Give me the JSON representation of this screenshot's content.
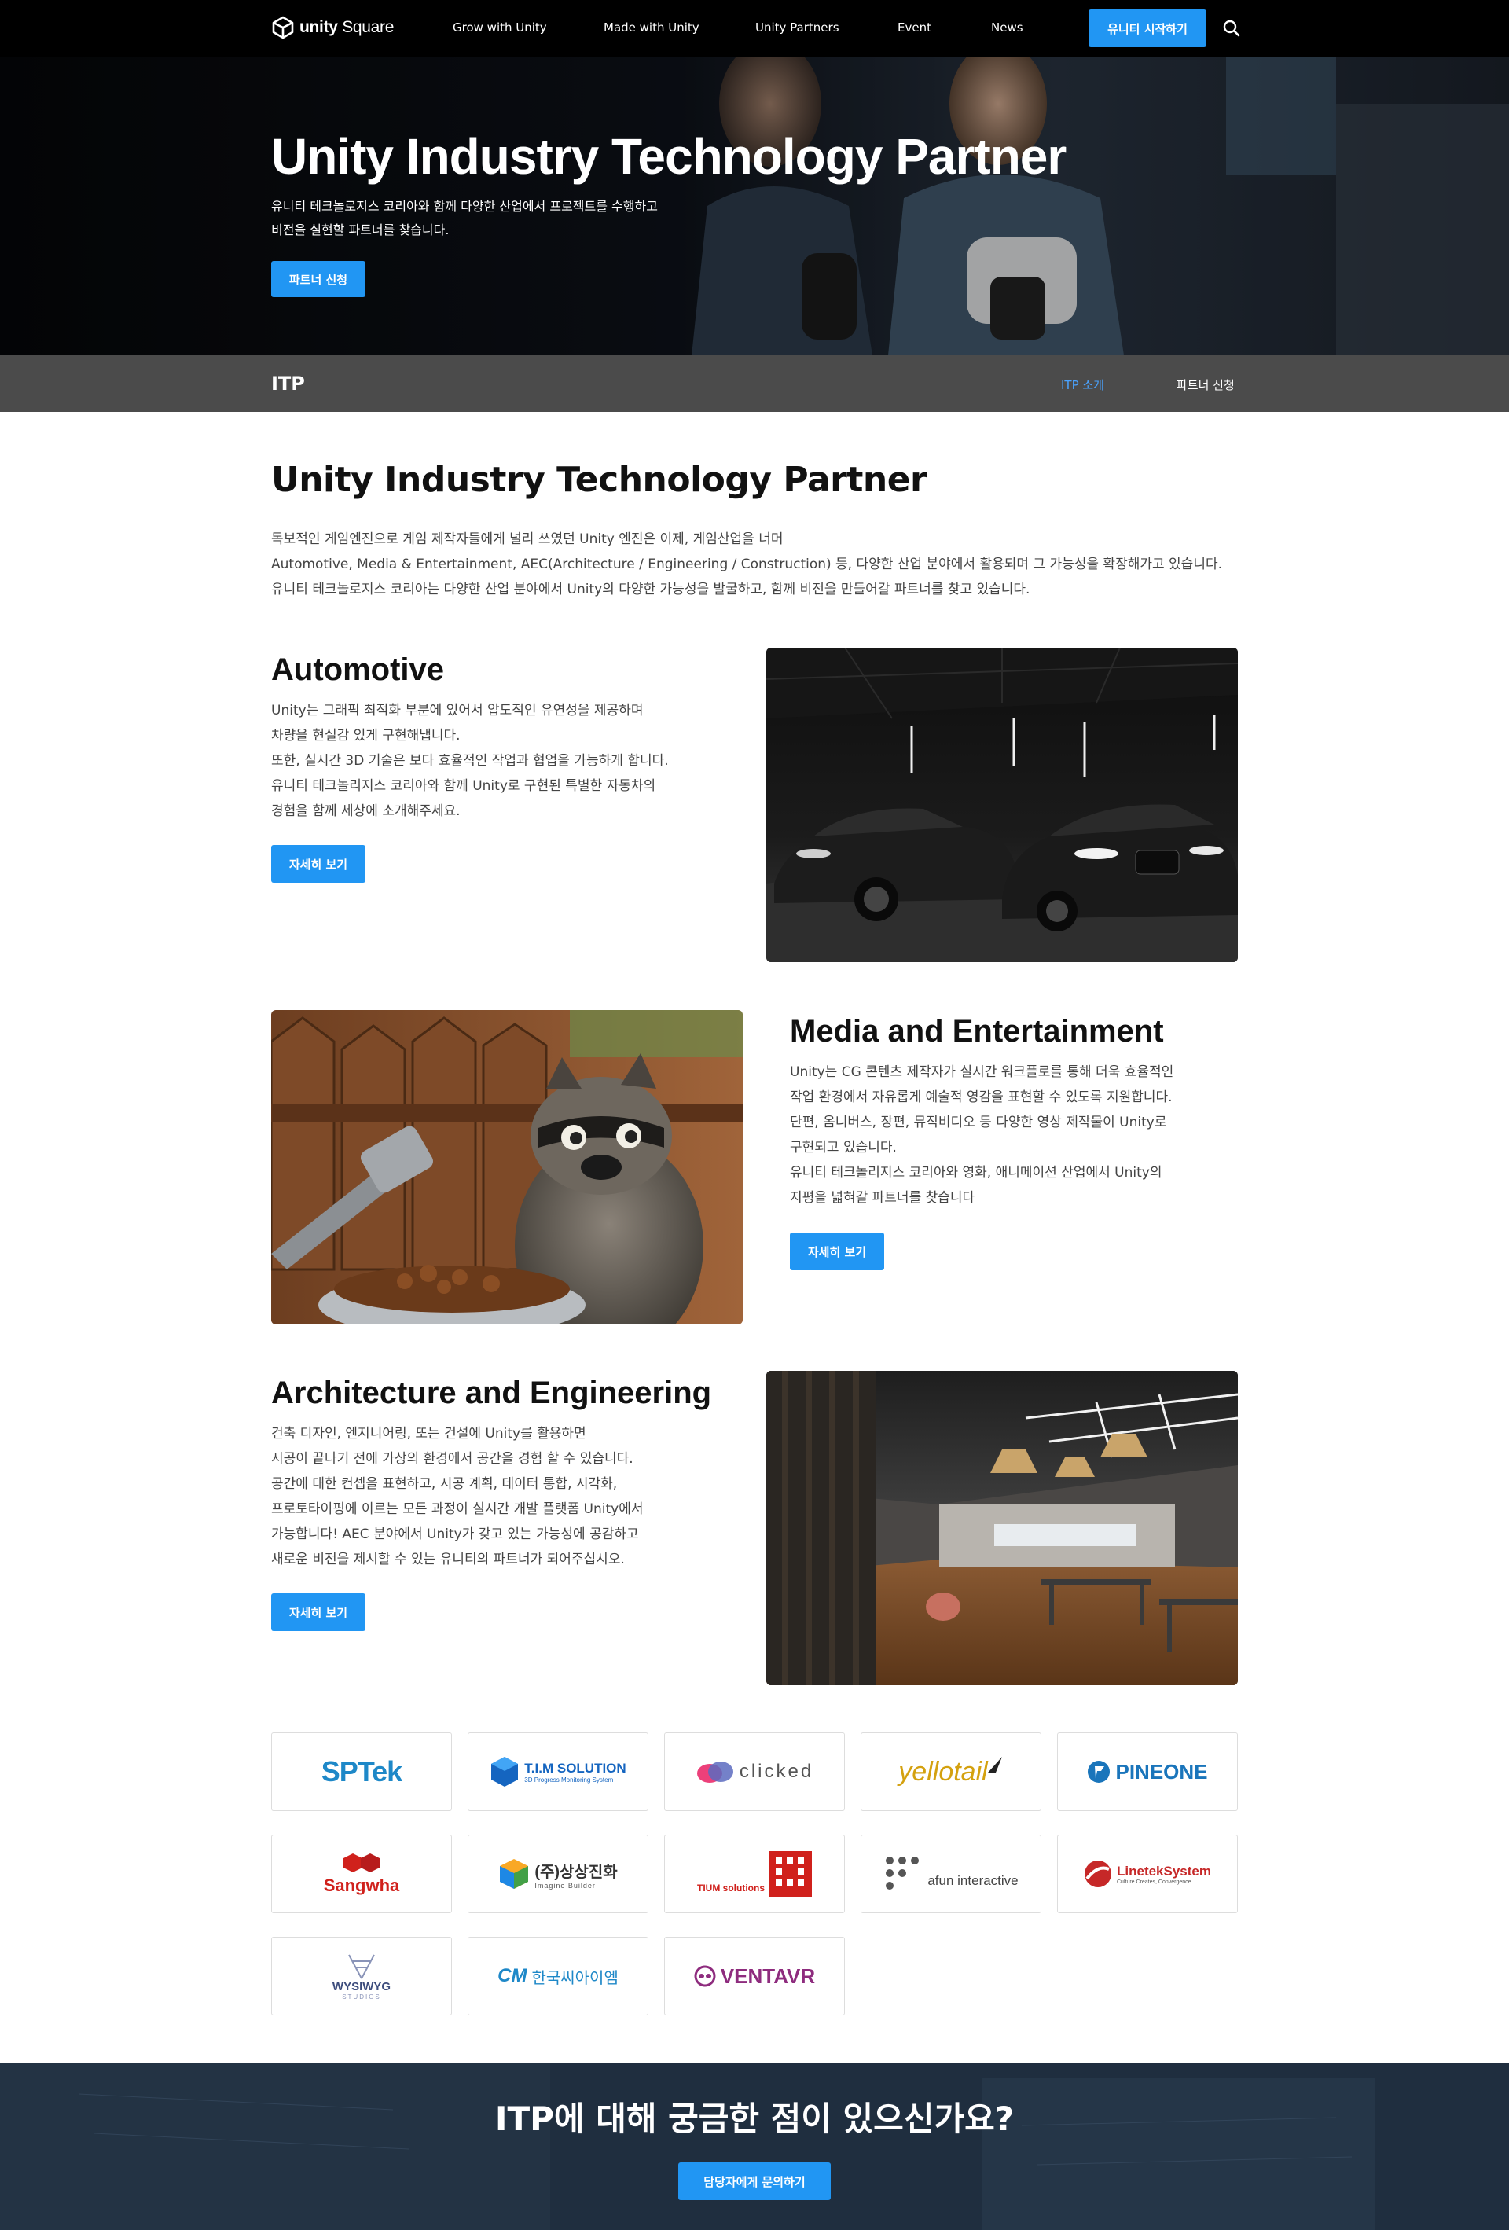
{
  "header": {
    "logo_text_bold": "unity",
    "logo_text_light": " Square",
    "nav": [
      "Grow with Unity",
      "Made with Unity",
      "Unity Partners",
      "Event",
      "News"
    ],
    "start_button": "유니티 시작하기"
  },
  "hero": {
    "title": "Unity Industry Technology Partner",
    "subtitle_lines": [
      "유니티 테크놀로지스 코리아와 함께 다양한 산업에서 프로젝트를 수행하고",
      "비전을 실현할 파트너를 찾습니다."
    ],
    "button": "파트너 신청"
  },
  "subnav": {
    "title": "ITP",
    "tabs": [
      "ITP 소개",
      "파트너 신청"
    ]
  },
  "intro": {
    "title": "Unity Industry Technology Partner",
    "lines": [
      "독보적인 게임엔진으로 게임 제작자들에게 널리 쓰였던 Unity 엔진은 이제, 게임산업을 너머",
      "Automotive, Media & Entertainment, AEC(Architecture / Engineering / Construction) 등, 다양한 산업 분야에서 활용되며 그 가능성을 확장해가고 있습니다.",
      "유니티 테크놀로지스 코리아는 다양한 산업 분야에서 Unity의 다양한 가능성을 발굴하고, 함께 비전을 만들어갈 파트너를 찾고 있습니다."
    ]
  },
  "sections": [
    {
      "title": "Automotive",
      "lines": [
        "Unity는 그래픽 최적화 부분에 있어서 압도적인 유연성을 제공하며",
        "차량을 현실감 있게 구현해냅니다.",
        "또한, 실시간 3D 기술은 보다 효율적인 작업과 협업을 가능하게 합니다.",
        "유니티 테크놀리지스 코리아와 함께 Unity로 구현된 특별한 자동차의",
        "경험을 함께 세상에 소개해주세요."
      ],
      "button": "자세히 보기"
    },
    {
      "title": "Media and Entertainment",
      "lines": [
        "Unity는 CG 콘텐츠 제작자가 실시간 워크플로를 통해 더욱 효율적인",
        "작업 환경에서 자유롭게 예술적 영감을 표현할 수 있도록 지원합니다.",
        "단편, 옴니버스, 장편, 뮤직비디오 등 다양한 영상 제작물이 Unity로",
        "구현되고 있습니다.",
        "유니티 테크놀리지스 코리아와 영화, 애니메이션 산업에서 Unity의",
        "지평을 넓혀갈 파트너를 찾습니다"
      ],
      "button": "자세히 보기"
    },
    {
      "title": "Architecture and Engineering",
      "lines": [
        "건축 디자인, 엔지니어링, 또는 건설에 Unity를 활용하면",
        "시공이 끝나기 전에 가상의 환경에서 공간을 경험 할 수 있습니다.",
        "공간에 대한 컨셉을 표현하고, 시공 계획, 데이터 통합, 시각화,",
        "프로토타이핑에 이르는 모든 과정이 실시간 개발 플랫폼 Unity에서",
        "가능합니다! AEC 분야에서 Unity가 갖고 있는 가능성에 공감하고",
        "새로운 비전을 제시할 수 있는 유니티의 파트너가 되어주십시오."
      ],
      "button": "자세히 보기"
    }
  ],
  "partners": [
    {
      "name": "SPTek",
      "color": "#1e88c8"
    },
    {
      "name": "T.I.M SOLUTION",
      "sub": "3D Progress Monitoring System",
      "color": "#1565c0"
    },
    {
      "name": "clicked",
      "color": "#555555"
    },
    {
      "name": "yellotail",
      "color": "#d4a10f"
    },
    {
      "name": "PINEONE",
      "color": "#1a75bb"
    },
    {
      "name": "Sangwha",
      "color": "#d0211c"
    },
    {
      "name": "(주)상상진화",
      "sub": "Imagine Builder",
      "color": "#333333"
    },
    {
      "name": "TIUM solutions",
      "color": "#d0211c"
    },
    {
      "name": "afun interactive",
      "color": "#444444"
    },
    {
      "name": "LinetekSystem",
      "sub": "Culture Creates, Convergence",
      "color": "#c62828"
    },
    {
      "name": "WYSIWYG",
      "sub": "STUDIOS",
      "color": "#3c4c7c"
    },
    {
      "name": "한국씨아이엠",
      "color": "#1e88c8"
    },
    {
      "name": "VENTAVR",
      "color": "#8e2c7e"
    }
  ],
  "cta": {
    "question": "ITP에 대해 궁금한 점이 있으신가요?",
    "button": "담당자에게 문의하기"
  },
  "colors": {
    "accent": "#2196f3",
    "subnav_bg": "#4b4b4b",
    "header_bg": "#000000"
  }
}
